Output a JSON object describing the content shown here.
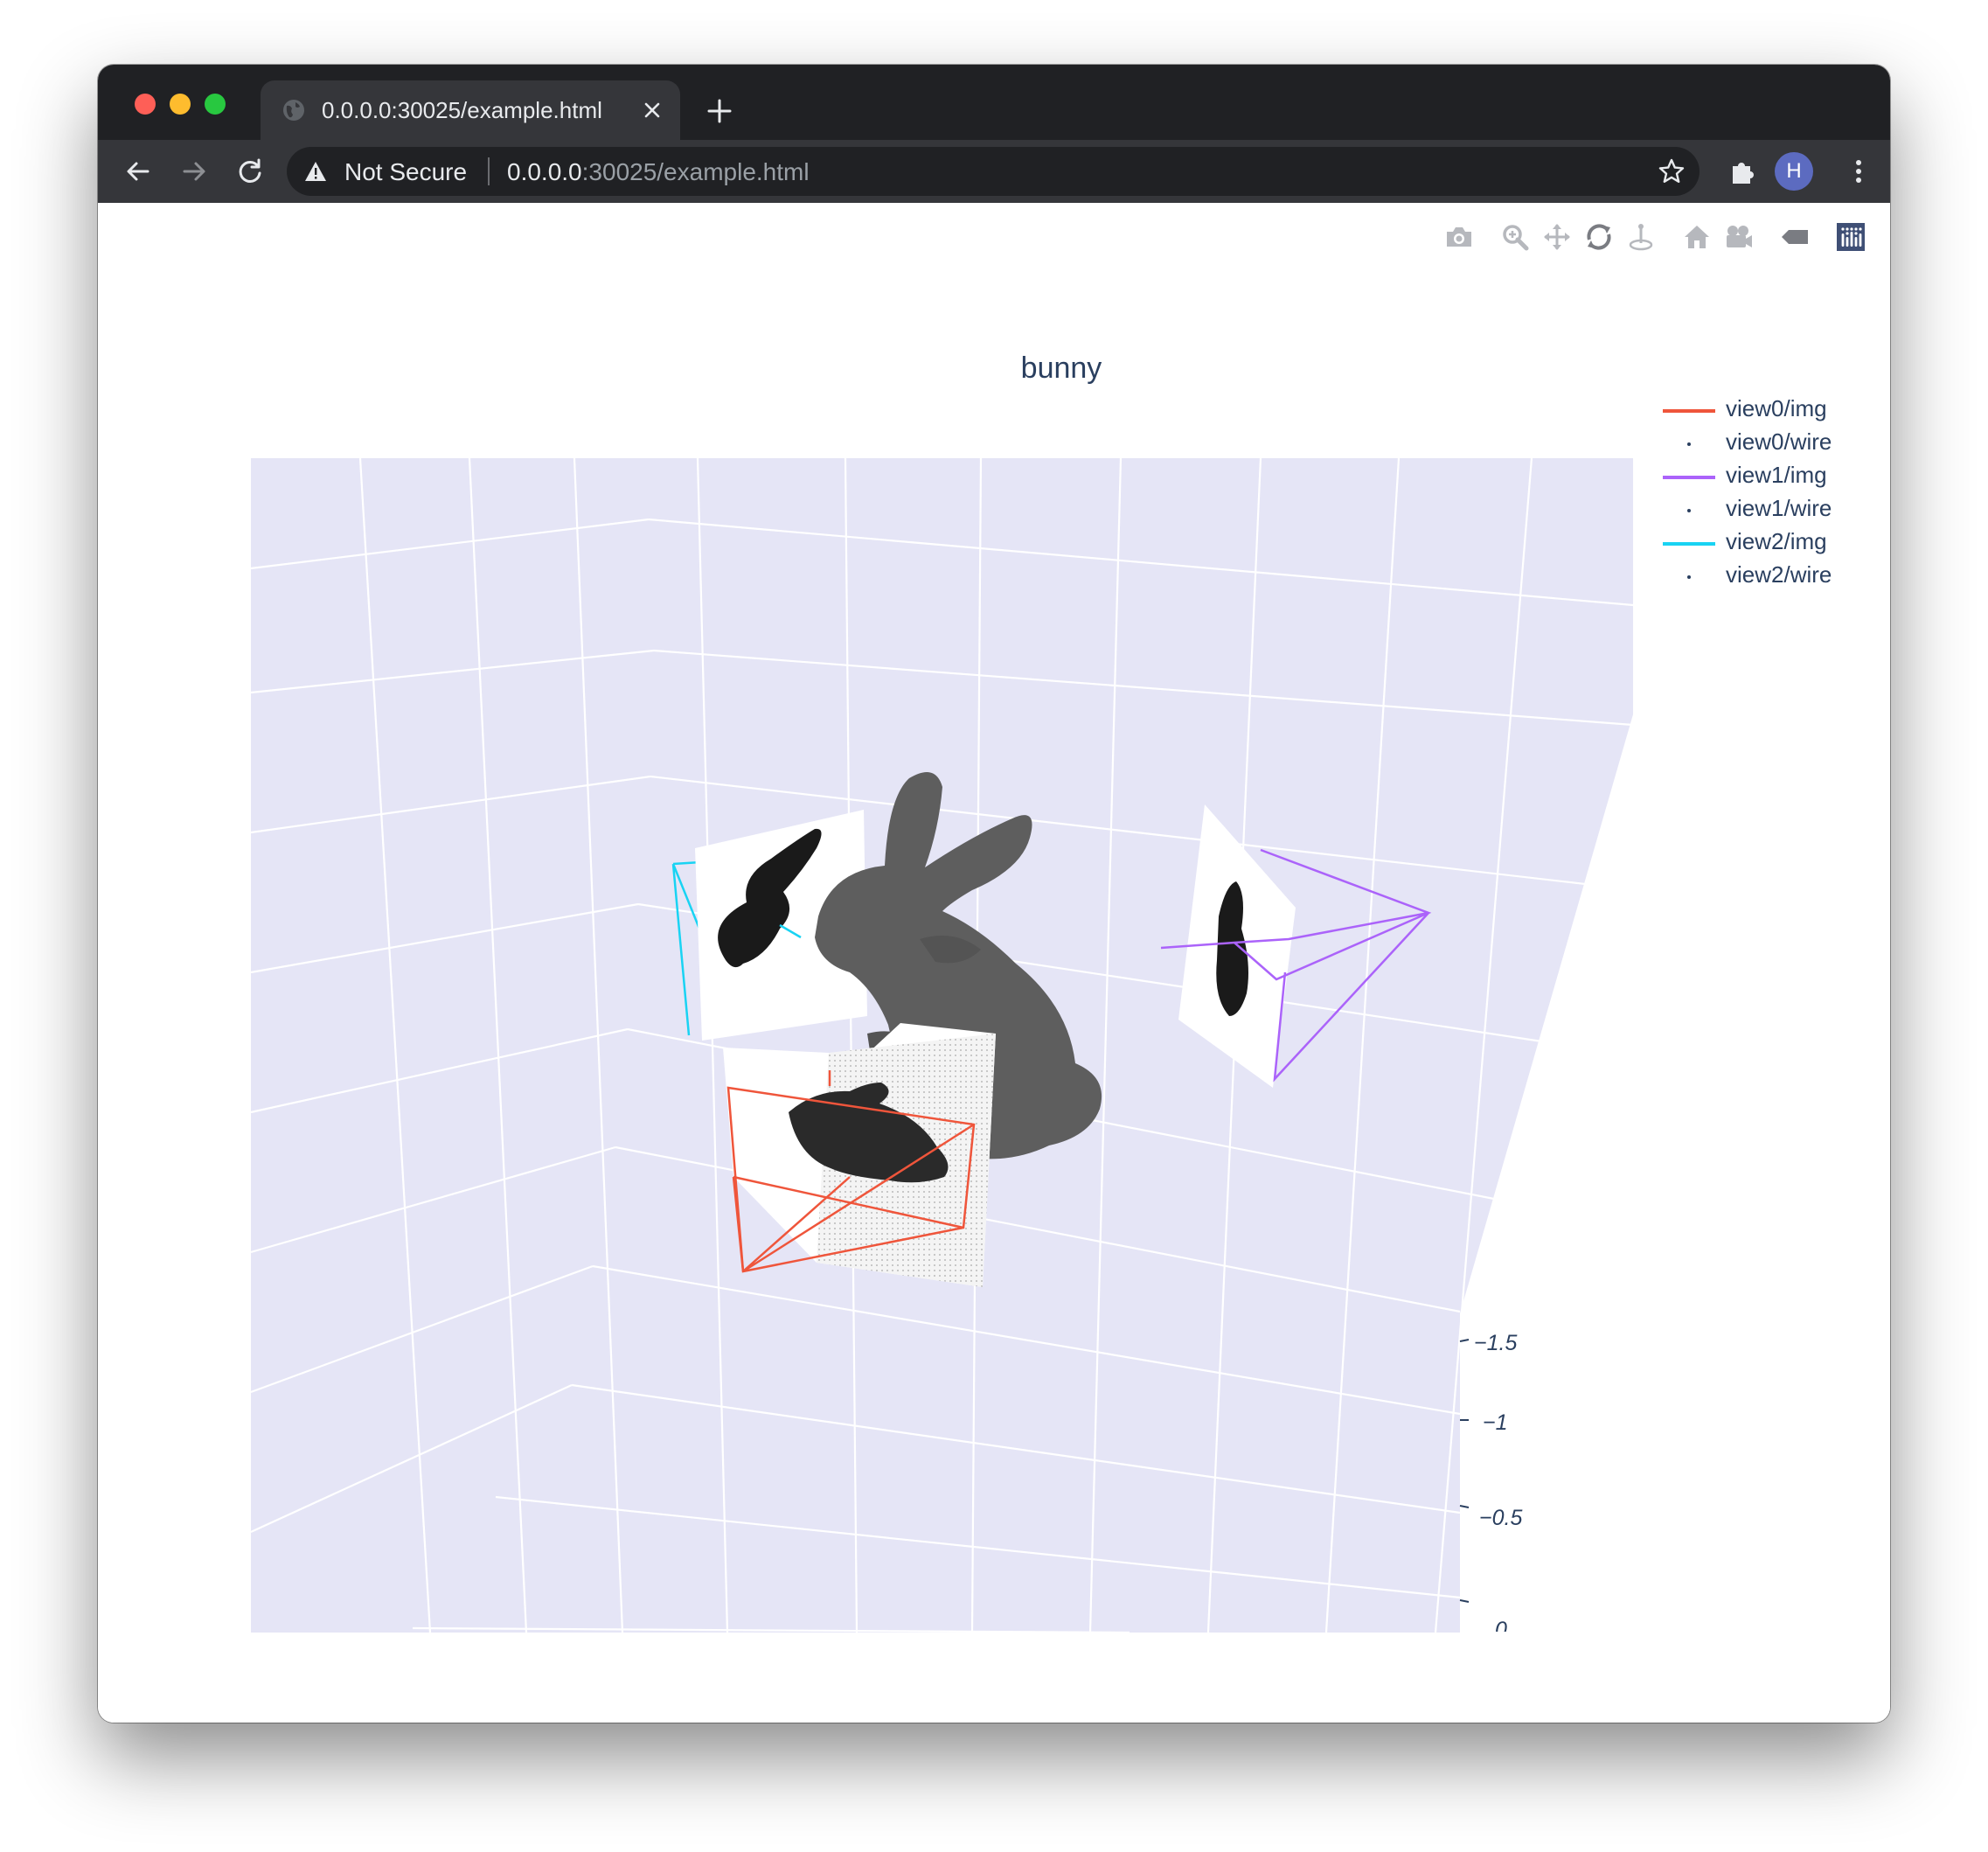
{
  "browser": {
    "tab_title": "0.0.0.0:30025/example.html",
    "security_label": "Not Secure",
    "url_host": "0.0.0.0",
    "url_rest": ":30025/example.html",
    "profile_initial": "H",
    "icons": [
      "globe-icon",
      "close-icon",
      "plus-icon",
      "back-arrow-icon",
      "forward-arrow-icon",
      "reload-icon",
      "warning-icon",
      "star-icon",
      "puzzle-icon",
      "kebab-menu-icon"
    ]
  },
  "modebar": {
    "icons": [
      "camera-icon",
      "zoom-icon",
      "pan-icon",
      "orbit-rotation-icon",
      "turntable-rotation-icon",
      "home-icon",
      "camera-view-icon",
      "hover-label-icon",
      "plotly-logo-icon"
    ]
  },
  "plot": {
    "title": "bunny",
    "background": "#e5e5f5",
    "z_axis_ticks": [
      "−1.5",
      "−1",
      "−0.5",
      "0"
    ],
    "legend": [
      {
        "label": "view0/img",
        "kind": "line",
        "color": "#ef553b"
      },
      {
        "label": "view0/wire",
        "kind": "dot",
        "color": "#2a3f5f"
      },
      {
        "label": "view1/img",
        "kind": "line",
        "color": "#ab63fa"
      },
      {
        "label": "view1/wire",
        "kind": "dot",
        "color": "#2a3f5f"
      },
      {
        "label": "view2/img",
        "kind": "line",
        "color": "#19d3f3"
      },
      {
        "label": "view2/wire",
        "kind": "dot",
        "color": "#2a3f5f"
      }
    ]
  }
}
